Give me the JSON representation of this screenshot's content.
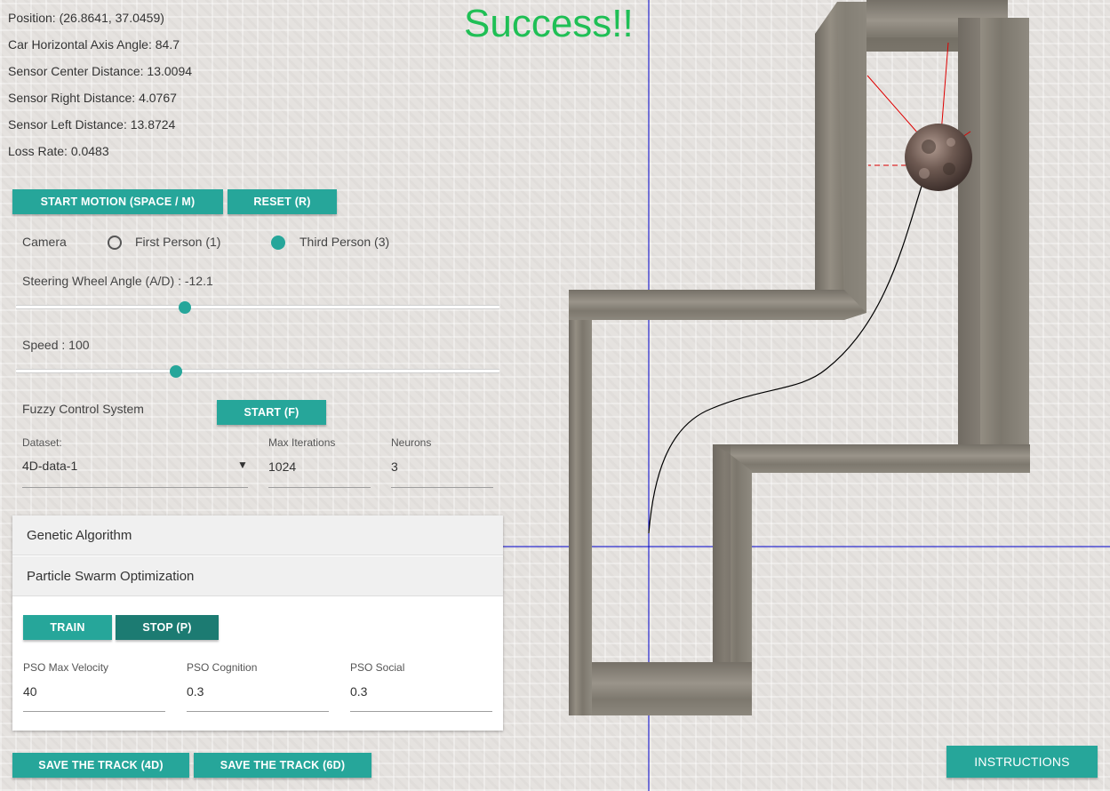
{
  "status": {
    "position": "Position: (26.8641, 37.0459)",
    "angle": "Car Horizontal Axis Angle: 84.7",
    "sensor_center": "Sensor Center Distance: 13.0094",
    "sensor_right": "Sensor Right Distance: 4.0767",
    "sensor_left": "Sensor Left Distance: 13.8724",
    "loss_rate": "Loss Rate: 0.0483"
  },
  "success_text": "Success!!",
  "controls": {
    "start_motion": "START MOTION (SPACE / M)",
    "reset": "RESET (R)",
    "camera_label": "Camera",
    "camera_options": [
      "First Person (1)",
      "Third Person (3)"
    ],
    "camera_selected": "Third Person (3)",
    "steering_label": "Steering Wheel Angle (A/D) : -12.1",
    "steering_level": 0.35,
    "speed_label": "Speed : 100",
    "speed_level": 0.33
  },
  "fuzzy": {
    "label": "Fuzzy Control System",
    "start": "START (F)"
  },
  "fields": {
    "dataset_label": "Dataset:",
    "dataset_value": "4D-data-1",
    "max_iter_label": "Max Iterations",
    "max_iter_value": "1024",
    "neurons_label": "Neurons",
    "neurons_value": "3"
  },
  "algorithms": {
    "genetic": "Genetic Algorithm",
    "pso": "Particle Swarm Optimization",
    "train": "TRAIN",
    "stop": "STOP (P)",
    "pso_max_velocity_label": "PSO Max Velocity",
    "pso_max_velocity_value": "40",
    "pso_cognition_label": "PSO Cognition",
    "pso_cognition_value": "0.3",
    "pso_social_label": "PSO Social",
    "pso_social_value": "0.3"
  },
  "footer": {
    "save_4d": "SAVE THE TRACK (4D)",
    "save_6d": "SAVE THE TRACK (6D)",
    "instructions": "INSTRUCTIONS"
  },
  "colors": {
    "accent": "#26a69a",
    "success": "#1fbf55",
    "axis": "#0000cc",
    "sensor": "#dd0000"
  },
  "icons": {
    "dropdown": "caret-down-icon"
  }
}
